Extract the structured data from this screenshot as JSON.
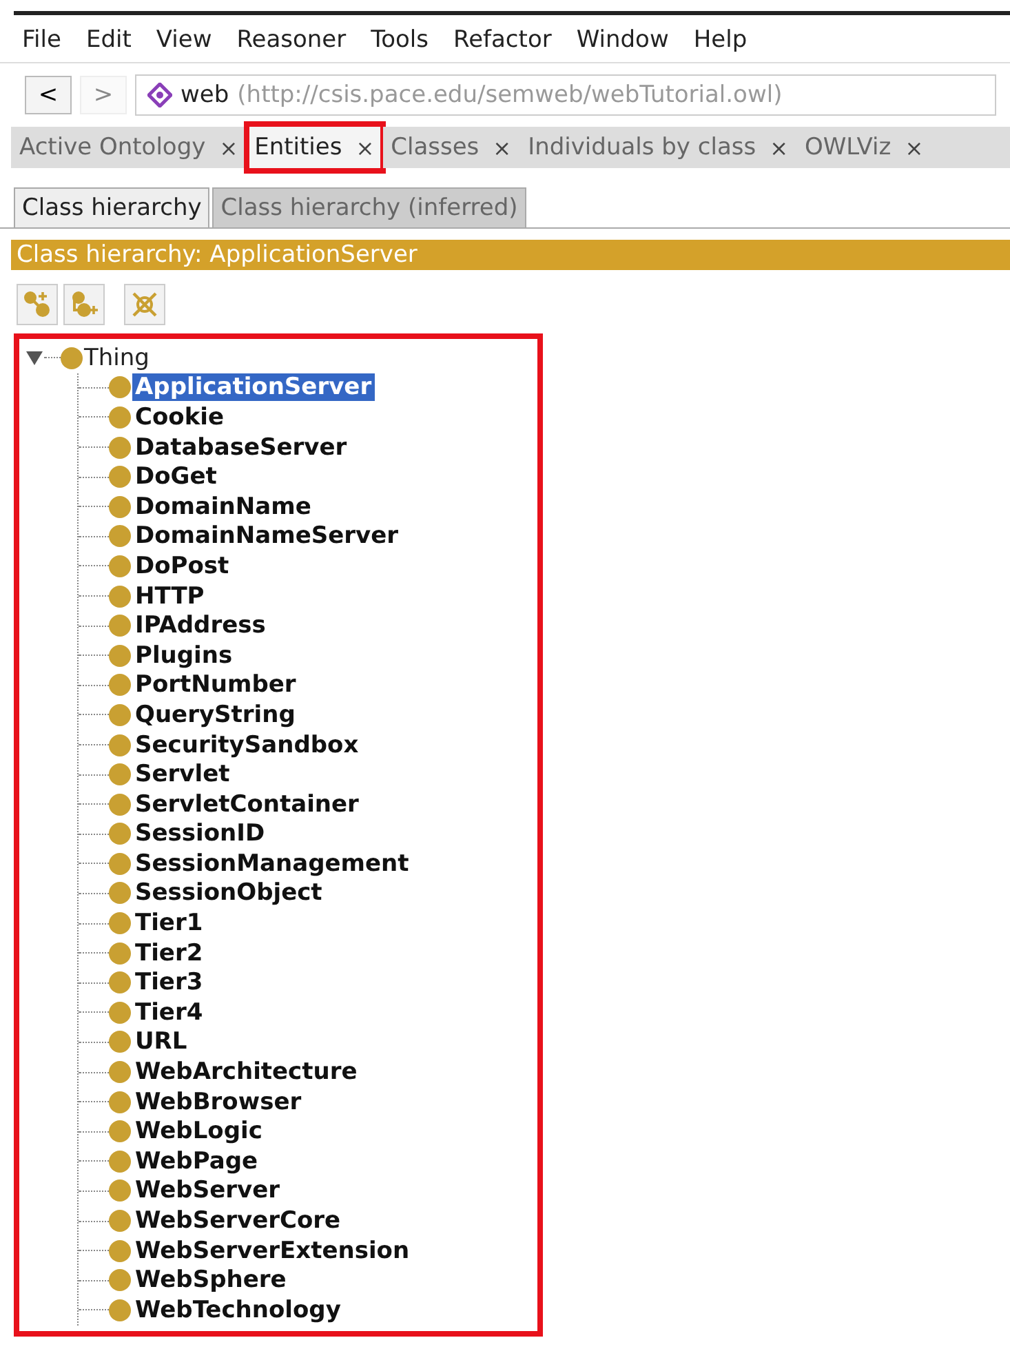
{
  "menu": [
    "File",
    "Edit",
    "View",
    "Reasoner",
    "Tools",
    "Refactor",
    "Window",
    "Help"
  ],
  "nav": {
    "back": "<",
    "forward": ">",
    "ontology": "web",
    "iri": "(http://csis.pace.edu/semweb/webTutorial.owl)"
  },
  "tabs": [
    {
      "label": "Active Ontology",
      "close": "×",
      "selected": false,
      "highlighted": false
    },
    {
      "label": "Entities",
      "close": "×",
      "selected": true,
      "highlighted": true
    },
    {
      "label": "Classes",
      "close": "×",
      "selected": false,
      "highlighted": false
    },
    {
      "label": "Individuals by class",
      "close": "×",
      "selected": false,
      "highlighted": false
    },
    {
      "label": "OWLViz",
      "close": "×",
      "selected": false,
      "highlighted": false
    }
  ],
  "subtabs": [
    {
      "label": "Class hierarchy",
      "selected": true
    },
    {
      "label": "Class hierarchy (inferred)",
      "selected": false
    }
  ],
  "view_header": "Class hierarchy: ApplicationServer",
  "tree": {
    "highlighted": true,
    "root": {
      "label": "Thing",
      "expanded": true,
      "selected": false,
      "children": [
        {
          "label": "ApplicationServer",
          "selected": true
        },
        {
          "label": "Cookie",
          "selected": false
        },
        {
          "label": "DatabaseServer",
          "selected": false
        },
        {
          "label": "DoGet",
          "selected": false
        },
        {
          "label": "DomainName",
          "selected": false
        },
        {
          "label": "DomainNameServer",
          "selected": false
        },
        {
          "label": "DoPost",
          "selected": false
        },
        {
          "label": "HTTP",
          "selected": false
        },
        {
          "label": "IPAddress",
          "selected": false
        },
        {
          "label": "Plugins",
          "selected": false
        },
        {
          "label": "PortNumber",
          "selected": false
        },
        {
          "label": "QueryString",
          "selected": false
        },
        {
          "label": "SecuritySandbox",
          "selected": false
        },
        {
          "label": "Servlet",
          "selected": false
        },
        {
          "label": "ServletContainer",
          "selected": false
        },
        {
          "label": "SessionID",
          "selected": false
        },
        {
          "label": "SessionManagement",
          "selected": false
        },
        {
          "label": "SessionObject",
          "selected": false
        },
        {
          "label": "Tier1",
          "selected": false
        },
        {
          "label": "Tier2",
          "selected": false
        },
        {
          "label": "Tier3",
          "selected": false
        },
        {
          "label": "Tier4",
          "selected": false
        },
        {
          "label": "URL",
          "selected": false
        },
        {
          "label": "WebArchitecture",
          "selected": false
        },
        {
          "label": "WebBrowser",
          "selected": false
        },
        {
          "label": "WebLogic",
          "selected": false
        },
        {
          "label": "WebPage",
          "selected": false
        },
        {
          "label": "WebServer",
          "selected": false
        },
        {
          "label": "WebServerCore",
          "selected": false
        },
        {
          "label": "WebServerExtension",
          "selected": false
        },
        {
          "label": "WebSphere",
          "selected": false
        },
        {
          "label": "WebTechnology",
          "selected": false
        }
      ]
    }
  }
}
